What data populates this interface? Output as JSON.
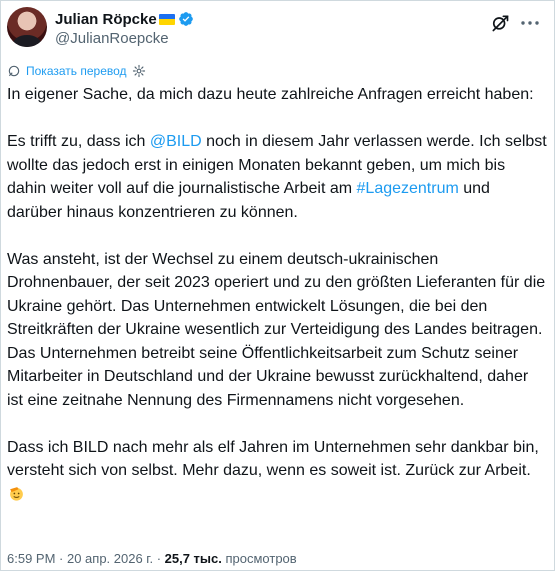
{
  "author": {
    "display_name": "Julian Röpcke",
    "handle": "@JulianRoepcke"
  },
  "icons": {
    "verified": "verified-badge-icon",
    "grok": "grok-icon",
    "more": "more-options-icon",
    "translate": "translate-icon",
    "settings": "gear-icon"
  },
  "colors": {
    "link": "#1d9bf0",
    "text": "#0f1419",
    "secondary": "#536471",
    "flag_blue": "#1d70f0",
    "flag_yellow": "#ffd500"
  },
  "translate_label": "Показать перевод",
  "post": {
    "p1": "In eigener Sache, da mich dazu heute zahlreiche Anfragen erreicht haben:",
    "p2_a": "Es trifft zu, dass ich ",
    "p2_mention": "@BILD",
    "p2_b": " noch in diesem Jahr verlassen werde. Ich selbst wollte das jedoch erst in einigen Monaten bekannt geben, um mich bis dahin weiter voll auf die journalistische Arbeit am ",
    "p2_hashtag": "#Lagezentrum",
    "p2_c": " und darüber hinaus konzentrieren zu können.",
    "p3": "Was ansteht, ist der Wechsel zu einem deutsch-ukrainischen Drohnenbauer, der seit 2023 operiert und zu den größten Lieferanten für die Ukraine gehört. Das Unternehmen entwickelt Lösungen, die bei den Streitkräften der Ukraine wesentlich zur Verteidigung des Landes beitragen. Das Unternehmen betreibt seine Öffentlichkeitsarbeit zum Schutz seiner Mitarbeiter in Deutschland und der Ukraine bewusst zurückhaltend, daher ist eine zeitnahe Nennung des Firmennamens nicht vorgesehen.",
    "p4": "Dass ich BILD nach mehr als elf Jahren im Unternehmen sehr dankbar bin, versteht sich von selbst. Mehr dazu, wenn es soweit ist. Zurück zur Arbeit."
  },
  "meta": {
    "time": "6:59 PM",
    "sep1": " · ",
    "date": "20 апр. 2026 г.",
    "sep2": " · ",
    "views_count": "25,7 тыс.",
    "views_label": " просмотров"
  }
}
